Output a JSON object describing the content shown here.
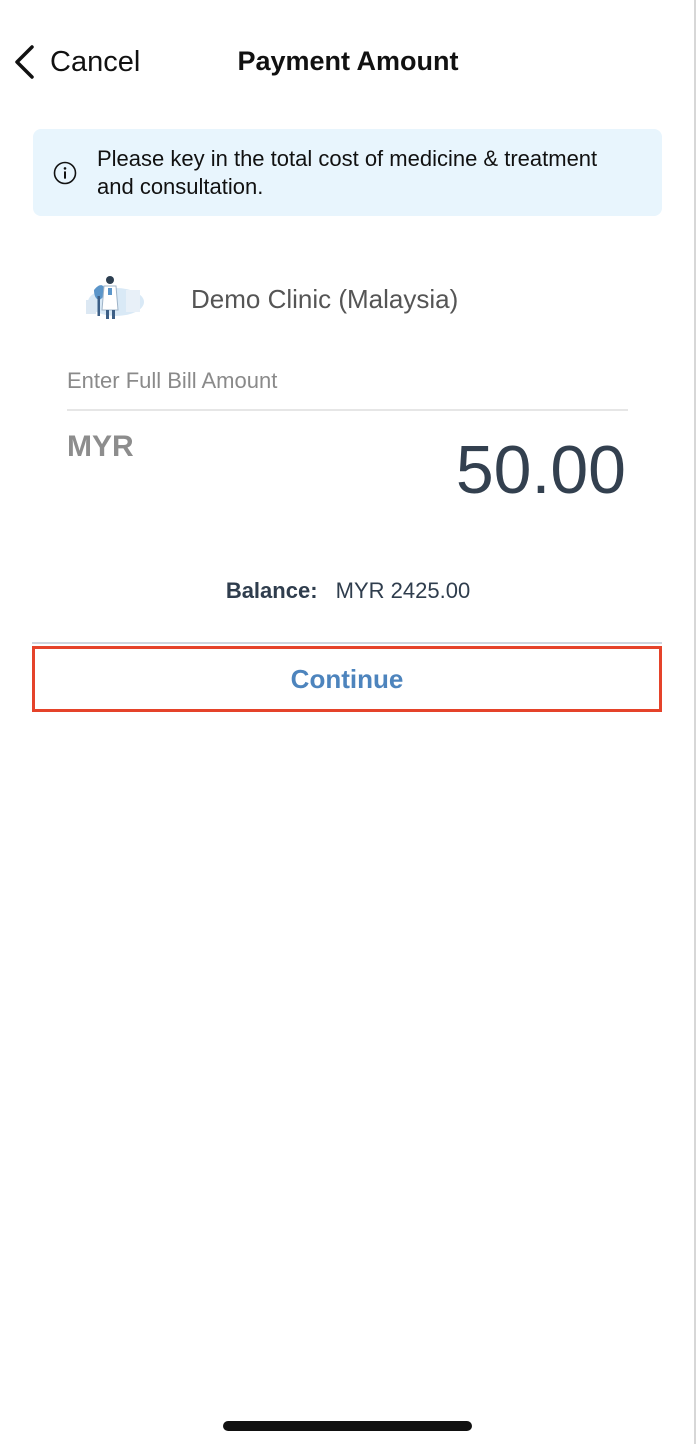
{
  "nav": {
    "back_label": "Cancel",
    "title": "Payment Amount"
  },
  "info_banner": {
    "icon": "info-icon",
    "text": "Please key in the total cost of medicine & treatment and consultation."
  },
  "clinic": {
    "illustration": "clinic-illustration",
    "name": "Demo Clinic (Malaysia)"
  },
  "amount": {
    "label": "Enter Full Bill Amount",
    "currency": "MYR",
    "value": "50.00"
  },
  "balance": {
    "label": "Balance:",
    "value": "MYR 2425.00"
  },
  "actions": {
    "continue_label": "Continue"
  },
  "colors": {
    "banner_bg": "#e8f5fd",
    "accent": "#4d84bd",
    "highlight": "#e5432a",
    "amount_text": "#33404f"
  }
}
